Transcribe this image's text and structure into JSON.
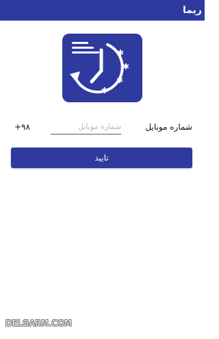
{
  "app_bar": {
    "title": "ریما"
  },
  "logo": {
    "icon": "clock-snowflake-logo-icon"
  },
  "form": {
    "mobile_label": "شماره موبایل",
    "phone_placeholder": "شماره موبایل",
    "phone_value": "",
    "country_code": "+۹۸"
  },
  "confirm_button": {
    "label": "تایید"
  },
  "watermark": {
    "text": "DELGARM.COM"
  },
  "colors": {
    "primary": "#2e3a9e",
    "background": "#ffffff"
  }
}
